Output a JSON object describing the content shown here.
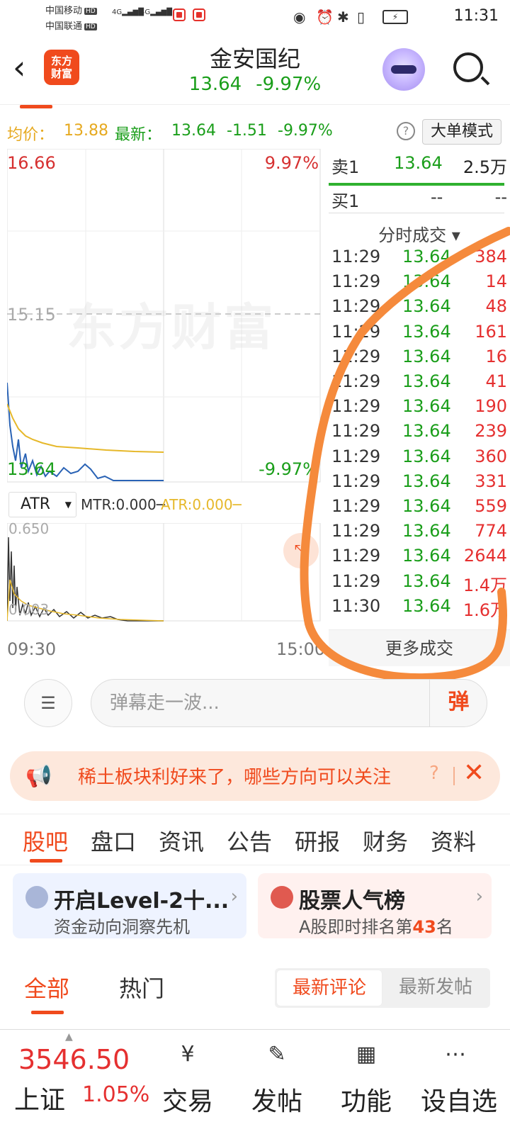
{
  "status": {
    "carrier1": "中国移动",
    "carrier2": "中国联通",
    "hd": "HD",
    "net": "4G",
    "time": "11:31"
  },
  "header": {
    "logo_text": "东方财富",
    "title": "金安国纪",
    "price": "13.64",
    "change_pct": "-9.97%"
  },
  "info": {
    "avg_label": "均价：",
    "avg_value": "13.88",
    "latest_label": "最新：",
    "latest_value": "13.64",
    "change": "-1.51",
    "change_pct": "-9.97%",
    "help": "?",
    "big_mode": "大单模式"
  },
  "chart": {
    "y_top": "16.66",
    "pct_top": "9.97%",
    "y_mid": "15.15",
    "y_bottom": "13.64",
    "pct_bottom": "-9.97%",
    "watermark": "东方财富",
    "indicator": "ATR",
    "mtr_label": "MTR:0.000─",
    "atr_label": "ATR:0.000─",
    "sub_y_top": "0.650",
    "sub_y_bottom": "0.003",
    "time_start": "09:30",
    "time_end": "15:00",
    "expand_icon": "expand-icon"
  },
  "chart_data": {
    "type": "line",
    "x_range": [
      "09:30",
      "15:00"
    ],
    "ylim": [
      13.64,
      16.66
    ],
    "reference": 15.15,
    "series": [
      {
        "name": "最新",
        "color": "#2a63b5"
      },
      {
        "name": "均价",
        "color": "#e6b82a",
        "values_hint": "13.88"
      }
    ],
    "sub": {
      "type": "line",
      "ylim": [
        0.003,
        0.65
      ],
      "series": [
        {
          "name": "MTR"
        },
        {
          "name": "ATR"
        }
      ]
    }
  },
  "orderbook": {
    "sell1": {
      "label": "卖1",
      "price": "13.64",
      "vol": "2.5万"
    },
    "buy1": {
      "label": "买1",
      "price": "--",
      "vol": "--"
    }
  },
  "ticks_header": "分时成交 ▾",
  "ticks": [
    {
      "t": "11:29",
      "p": "13.64",
      "v": "384"
    },
    {
      "t": "11:29",
      "p": "13.64",
      "v": "14"
    },
    {
      "t": "11:29",
      "p": "13.64",
      "v": "48"
    },
    {
      "t": "11:29",
      "p": "13.64",
      "v": "161"
    },
    {
      "t": "11:29",
      "p": "13.64",
      "v": "16"
    },
    {
      "t": "11:29",
      "p": "13.64",
      "v": "41"
    },
    {
      "t": "11:29",
      "p": "13.64",
      "v": "190"
    },
    {
      "t": "11:29",
      "p": "13.64",
      "v": "239"
    },
    {
      "t": "11:29",
      "p": "13.64",
      "v": "360"
    },
    {
      "t": "11:29",
      "p": "13.64",
      "v": "331"
    },
    {
      "t": "11:29",
      "p": "13.64",
      "v": "559"
    },
    {
      "t": "11:29",
      "p": "13.64",
      "v": "774"
    },
    {
      "t": "11:29",
      "p": "13.64",
      "v": "2644"
    },
    {
      "t": "11:29",
      "p": "13.64",
      "v": "1.4万"
    },
    {
      "t": "11:30",
      "p": "13.64",
      "v": "1.6万"
    }
  ],
  "more_trades": "更多成交",
  "danmu": {
    "placeholder": "弹幕走一波...",
    "button": "弹"
  },
  "banner": {
    "text": "稀土板块利好来了，哪些方向可以关注",
    "q": "?"
  },
  "tabs": [
    "股吧",
    "盘口",
    "资讯",
    "公告",
    "研报",
    "财务",
    "资料"
  ],
  "cards": [
    {
      "title": "开启Level-2十...",
      "sub": "资金动向洞察先机"
    },
    {
      "title": "股票人气榜",
      "sub_prefix": "A股即时排名第",
      "rank": "43",
      "sub_suffix": "名"
    }
  ],
  "filters": {
    "all": "全部",
    "hot": "热门",
    "latest_comments": "最新评论",
    "latest_posts": "最新发帖"
  },
  "bottom": {
    "index_value": "3546.50",
    "index_name": "上证",
    "index_pct": "1.05%",
    "nav": [
      "交易",
      "发帖",
      "功能",
      "设自选"
    ]
  }
}
